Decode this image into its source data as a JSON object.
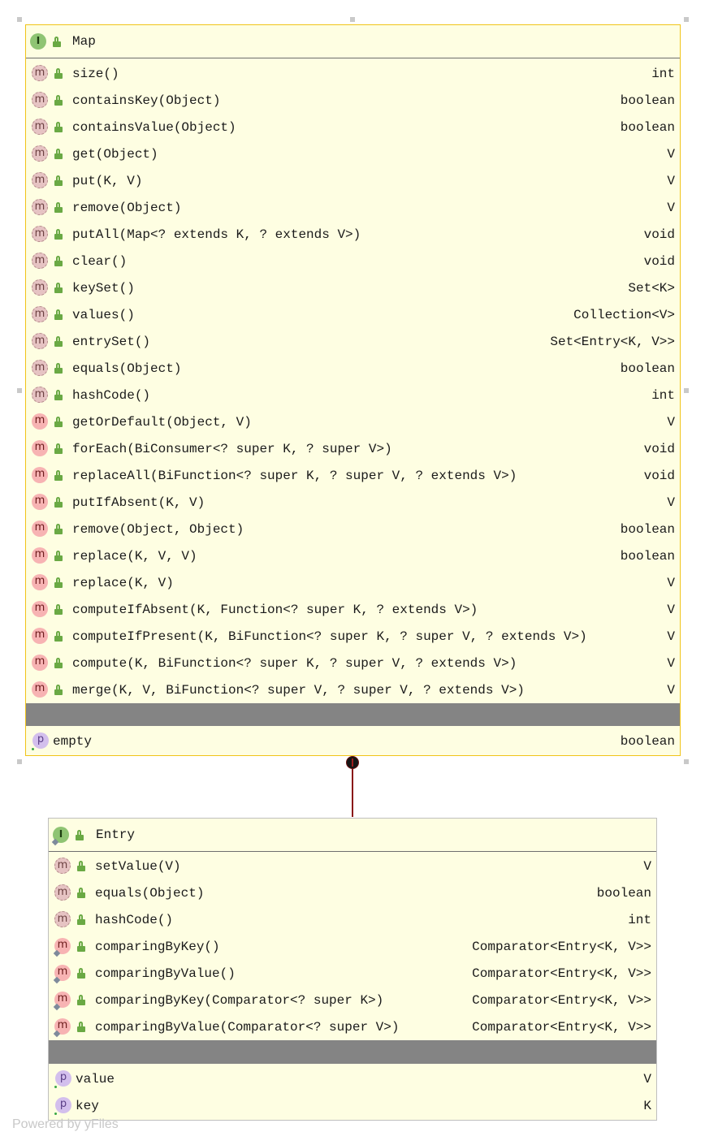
{
  "colors": {
    "box_fill": "#fefee2",
    "selected_border": "#f0c419",
    "separator": "#848484",
    "connector": "#8a1313"
  },
  "map": {
    "title": "Map",
    "kind_icon": "interface-icon",
    "methods": [
      {
        "name": "size()",
        "type": "int"
      },
      {
        "name": "containsKey(Object)",
        "type": "boolean"
      },
      {
        "name": "containsValue(Object)",
        "type": "boolean"
      },
      {
        "name": "get(Object)",
        "type": "V"
      },
      {
        "name": "put(K, V)",
        "type": "V"
      },
      {
        "name": "remove(Object)",
        "type": "V"
      },
      {
        "name": "putAll(Map<? extends K, ? extends V>)",
        "type": "void"
      },
      {
        "name": "clear()",
        "type": "void"
      },
      {
        "name": "keySet()",
        "type": "Set<K>"
      },
      {
        "name": "values()",
        "type": "Collection<V>"
      },
      {
        "name": "entrySet()",
        "type": "Set<Entry<K, V>>"
      },
      {
        "name": "equals(Object)",
        "type": "boolean"
      },
      {
        "name": "hashCode()",
        "type": "int"
      },
      {
        "name": "getOrDefault(Object, V)",
        "type": "V"
      },
      {
        "name": "forEach(BiConsumer<? super K, ? super V>)",
        "type": "void"
      },
      {
        "name": "replaceAll(BiFunction<? super K, ? super V, ? extends V>)",
        "type": "void"
      },
      {
        "name": "putIfAbsent(K, V)",
        "type": "V"
      },
      {
        "name": "remove(Object, Object)",
        "type": "boolean"
      },
      {
        "name": "replace(K, V, V)",
        "type": "boolean"
      },
      {
        "name": "replace(K, V)",
        "type": "V"
      },
      {
        "name": "computeIfAbsent(K, Function<? super K, ? extends V>)",
        "type": "V"
      },
      {
        "name": "computeIfPresent(K, BiFunction<? super K, ? super V, ? extends V>)",
        "type": "V"
      },
      {
        "name": "compute(K, BiFunction<? super K, ? super V, ? extends V>)",
        "type": "V"
      },
      {
        "name": "merge(K, V, BiFunction<? super V, ? super V, ? extends V>)",
        "type": "V"
      }
    ],
    "properties": [
      {
        "name": "empty",
        "type": "boolean"
      }
    ]
  },
  "entry": {
    "title": "Entry",
    "kind_icon": "interface-icon",
    "methods": [
      {
        "name": "setValue(V)",
        "type": "V"
      },
      {
        "name": "equals(Object)",
        "type": "boolean"
      },
      {
        "name": "hashCode()",
        "type": "int"
      },
      {
        "name": "comparingByKey()",
        "type": "Comparator<Entry<K, V>>"
      },
      {
        "name": "comparingByValue()",
        "type": "Comparator<Entry<K, V>>"
      },
      {
        "name": "comparingByKey(Comparator<? super K>)",
        "type": "Comparator<Entry<K, V>>"
      },
      {
        "name": "comparingByValue(Comparator<? super V>)",
        "type": "Comparator<Entry<K, V>>"
      }
    ],
    "properties": [
      {
        "name": "value",
        "type": "V"
      },
      {
        "name": "key",
        "type": "K"
      }
    ]
  },
  "watermark": "Powered by yFiles"
}
